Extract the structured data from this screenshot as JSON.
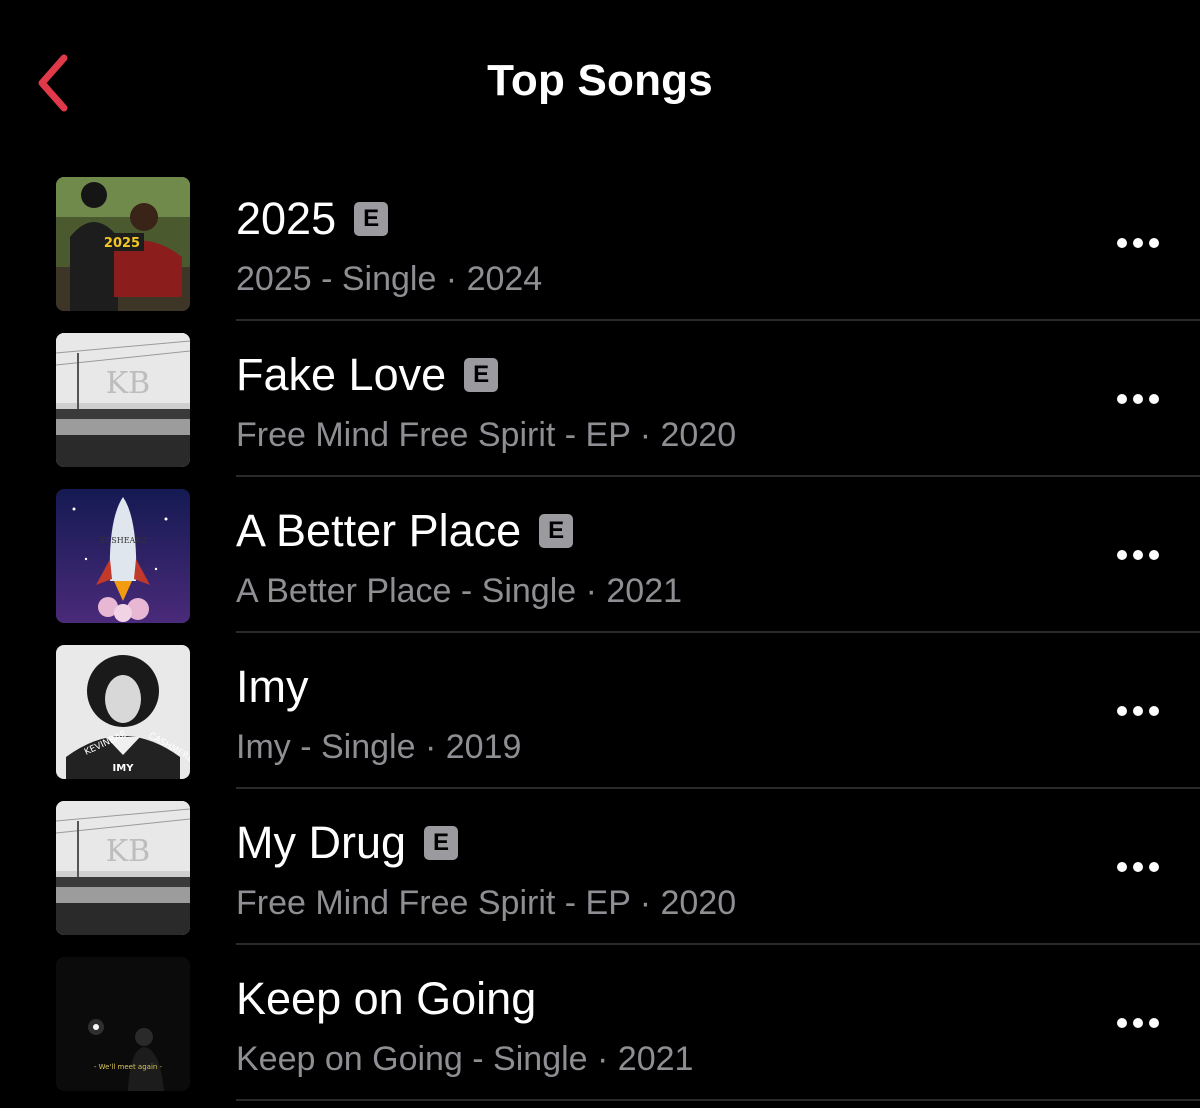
{
  "nav": {
    "title": "Top Songs",
    "back_icon": "chevron-left-icon",
    "accent_color": "#e0394a"
  },
  "songs": [
    {
      "title": "2025",
      "explicit": true,
      "explicit_label": "E",
      "subtitle": "2025 - Single · 2024",
      "artwork": "artwork-2025-single"
    },
    {
      "title": "Fake Love",
      "explicit": true,
      "explicit_label": "E",
      "subtitle": "Free Mind Free Spirit - EP · 2020",
      "artwork": "artwork-free-mind-free-spirit"
    },
    {
      "title": "A Better Place",
      "explicit": true,
      "explicit_label": "E",
      "subtitle": "A Better Place - Single · 2021",
      "artwork": "artwork-a-better-place"
    },
    {
      "title": "Imy",
      "explicit": false,
      "explicit_label": "",
      "subtitle": "Imy - Single · 2019",
      "artwork": "artwork-imy-single"
    },
    {
      "title": "My Drug",
      "explicit": true,
      "explicit_label": "E",
      "subtitle": "Free Mind Free Spirit - EP · 2020",
      "artwork": "artwork-free-mind-free-spirit"
    },
    {
      "title": "Keep on Going",
      "explicit": false,
      "explicit_label": "",
      "subtitle": "Keep on Going - Single · 2021",
      "artwork": "artwork-keep-on-going"
    }
  ],
  "more_icon": "ellipsis-icon",
  "colors": {
    "background": "#000000",
    "primary_text": "#ffffff",
    "secondary_text": "#8e8e93",
    "explicit_badge": "#9a9a9f",
    "divider": "#2a2a2c"
  }
}
